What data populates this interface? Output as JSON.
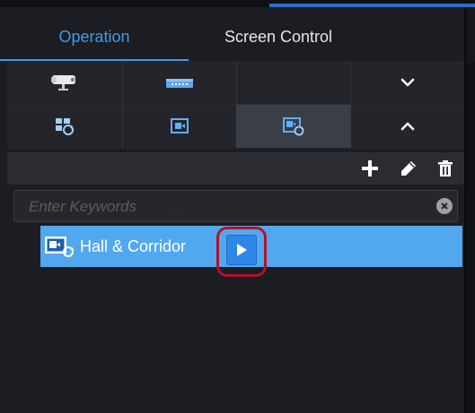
{
  "tabs": [
    {
      "label": "Operation",
      "active": true
    },
    {
      "label": "Screen Control",
      "active": false
    }
  ],
  "grid": {
    "row1": [
      "camera-icon",
      "encoder-device-icon",
      "empty",
      "chevron-down-icon"
    ],
    "row2": [
      "scene-icon",
      "video-window-icon",
      "video-playback-icon",
      "chevron-up-icon"
    ],
    "selected": "video-playback-icon"
  },
  "toolbar": [
    "add-icon",
    "edit-icon",
    "delete-icon"
  ],
  "search": {
    "placeholder": "Enter Keywords",
    "value": ""
  },
  "list": [
    {
      "label": "Hall & Corridor",
      "icon": "scene-playback-icon",
      "selected": true
    }
  ],
  "colors": {
    "accent": "#3f9bea",
    "row_selected": "#52a8ee",
    "play_button": "#2f86e6",
    "highlight_ring": "#b3122a"
  }
}
